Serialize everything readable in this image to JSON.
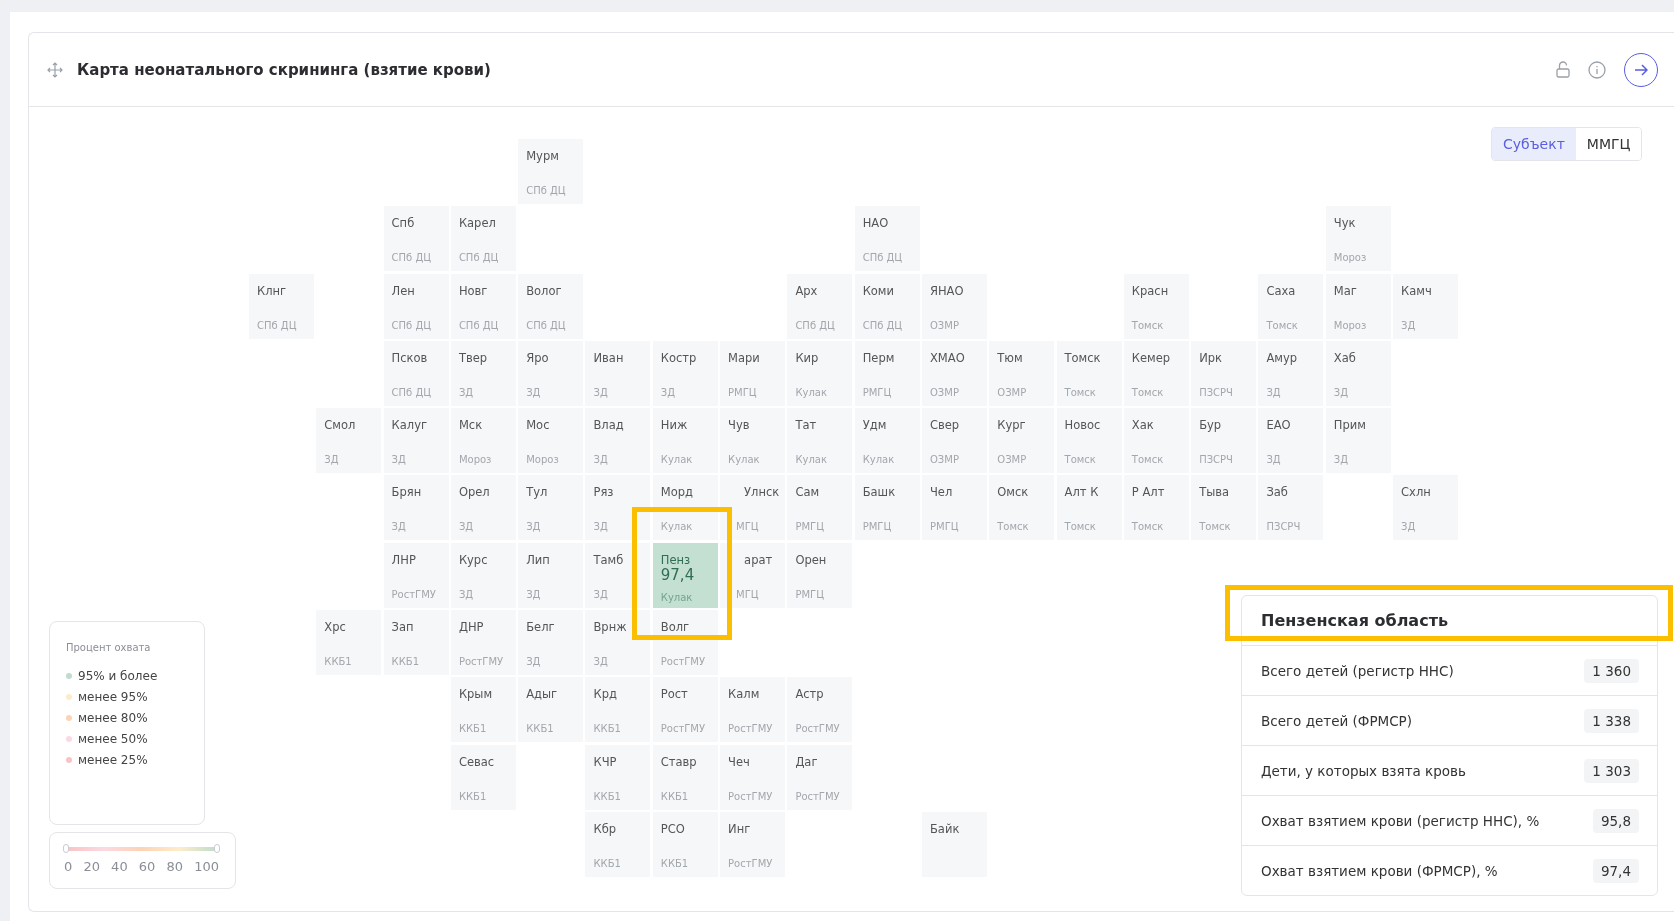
{
  "widget": {
    "title": "Карта неонатального скрининга (взятие крови)"
  },
  "view_toggle": [
    {
      "label": "Субъект",
      "selected": true
    },
    {
      "label": "ММГЦ",
      "selected": false
    }
  ],
  "map_rows": [
    [
      null,
      null,
      null,
      null,
      {
        "name": "Мурм",
        "org": "СПб ДЦ",
        "selected": false
      }
    ],
    [
      null,
      null,
      {
        "name": "Спб",
        "org": "СПб ДЦ",
        "selected": false
      },
      {
        "name": "Карел",
        "org": "СПб ДЦ",
        "selected": false
      },
      null,
      null,
      null,
      null,
      null,
      {
        "name": "НАО",
        "org": "СПб ДЦ",
        "selected": false
      },
      null,
      null,
      null,
      null,
      null,
      null,
      {
        "name": "Чук",
        "org": "Мороз",
        "selected": false
      }
    ],
    [
      {
        "name": "Клнг",
        "org": "СПб ДЦ",
        "selected": false
      },
      null,
      {
        "name": "Лен",
        "org": "СПб ДЦ",
        "selected": false
      },
      {
        "name": "Новг",
        "org": "СПб ДЦ",
        "selected": false
      },
      {
        "name": "Волог",
        "org": "СПб ДЦ",
        "selected": false
      },
      null,
      null,
      null,
      {
        "name": "Арх",
        "org": "СПб ДЦ",
        "selected": false
      },
      {
        "name": "Коми",
        "org": "СПб ДЦ",
        "selected": false
      },
      {
        "name": "ЯНАО",
        "org": "ОЗМР",
        "selected": false
      },
      null,
      null,
      {
        "name": "Красн",
        "org": "Томск",
        "selected": false
      },
      null,
      {
        "name": "Саха",
        "org": "Томск",
        "selected": false
      },
      {
        "name": "Маг",
        "org": "Мороз",
        "selected": false
      },
      {
        "name": "Камч",
        "org": "ЗД",
        "selected": false
      }
    ],
    [
      null,
      null,
      {
        "name": "Псков",
        "org": "СПб ДЦ",
        "selected": false
      },
      {
        "name": "Твер",
        "org": "ЗД",
        "selected": false
      },
      {
        "name": "Яро",
        "org": "ЗД",
        "selected": false
      },
      {
        "name": "Иван",
        "org": "ЗД",
        "selected": false
      },
      {
        "name": "Костр",
        "org": "ЗД",
        "selected": false
      },
      {
        "name": "Мари",
        "org": "РМГЦ",
        "selected": false
      },
      {
        "name": "Кир",
        "org": "Кулак",
        "selected": false
      },
      {
        "name": "Перм",
        "org": "РМГЦ",
        "selected": false
      },
      {
        "name": "ХМАО",
        "org": "ОЗМР",
        "selected": false
      },
      {
        "name": "Тюм",
        "org": "ОЗМР",
        "selected": false
      },
      {
        "name": "Томск",
        "org": "Томск",
        "selected": false
      },
      {
        "name": "Кемер",
        "org": "Томск",
        "selected": false
      },
      {
        "name": "Ирк",
        "org": "ПЗСРЧ",
        "selected": false
      },
      {
        "name": "Амур",
        "org": "ЗД",
        "selected": false
      },
      {
        "name": "Хаб",
        "org": "ЗД",
        "selected": false
      }
    ],
    [
      null,
      {
        "name": "Смол",
        "org": "ЗД",
        "selected": false
      },
      {
        "name": "Калуг",
        "org": "ЗД",
        "selected": false
      },
      {
        "name": "Мск",
        "org": "Мороз",
        "selected": false
      },
      {
        "name": "Мос",
        "org": "Мороз",
        "selected": false
      },
      {
        "name": "Влад",
        "org": "ЗД",
        "selected": false
      },
      {
        "name": "Ниж",
        "org": "Кулак",
        "selected": false
      },
      {
        "name": "Чув",
        "org": "Кулак",
        "selected": false
      },
      {
        "name": "Тат",
        "org": "Кулак",
        "selected": false
      },
      {
        "name": "Удм",
        "org": "Кулак",
        "selected": false
      },
      {
        "name": "Свер",
        "org": "ОЗМР",
        "selected": false
      },
      {
        "name": "Кург",
        "org": "ОЗМР",
        "selected": false
      },
      {
        "name": "Новос",
        "org": "Томск",
        "selected": false
      },
      {
        "name": "Хак",
        "org": "Томск",
        "selected": false
      },
      {
        "name": "Бур",
        "org": "ПЗСРЧ",
        "selected": false
      },
      {
        "name": "ЕАО",
        "org": "ЗД",
        "selected": false
      },
      {
        "name": "Прим",
        "org": "ЗД",
        "selected": false
      }
    ],
    [
      null,
      null,
      {
        "name": "Брян",
        "org": "ЗД",
        "selected": false
      },
      {
        "name": "Орел",
        "org": "ЗД",
        "selected": false
      },
      {
        "name": "Тул",
        "org": "ЗД",
        "selected": false
      },
      {
        "name": "Ряз",
        "org": "ЗД",
        "selected": false
      },
      {
        "name": "Морд",
        "org": "Кулак",
        "selected": false
      },
      {
        "name": "Улнск",
        "org": "МГЦ",
        "selected": false,
        "kind": "covered"
      },
      {
        "name": "Сам",
        "org": "РМГЦ",
        "selected": false
      },
      {
        "name": "Башк",
        "org": "РМГЦ",
        "selected": false
      },
      {
        "name": "Чел",
        "org": "РМГЦ",
        "selected": false
      },
      {
        "name": "Омск",
        "org": "Томск",
        "selected": false
      },
      {
        "name": "Алт К",
        "org": "Томск",
        "selected": false
      },
      {
        "name": "Р Алт",
        "org": "Томск",
        "selected": false
      },
      {
        "name": "Тыва",
        "org": "Томск",
        "selected": false
      },
      {
        "name": "Заб",
        "org": "ПЗСРЧ",
        "selected": false
      },
      null,
      {
        "name": "Схлн",
        "org": "ЗД",
        "selected": false
      }
    ],
    [
      null,
      null,
      {
        "name": "ЛНР",
        "org": "РостГМУ",
        "selected": false
      },
      {
        "name": "Курс",
        "org": "ЗД",
        "selected": false
      },
      {
        "name": "Лип",
        "org": "ЗД",
        "selected": false
      },
      {
        "name": "Тамб",
        "org": "ЗД",
        "selected": false
      },
      {
        "name": "Пенз",
        "value": "97,4",
        "org": "Кулак",
        "selected": true
      },
      {
        "name": "арат",
        "org": "МГЦ",
        "selected": false,
        "kind": "covered"
      },
      {
        "name": "Орен",
        "org": "РМГЦ",
        "selected": false
      }
    ],
    [
      null,
      {
        "name": "Хрс",
        "org": "ККБ1",
        "selected": false
      },
      {
        "name": "Зап",
        "org": "ККБ1",
        "selected": false
      },
      {
        "name": "ДНР",
        "org": "РостГМУ",
        "selected": false
      },
      {
        "name": "Белг",
        "org": "ЗД",
        "selected": false
      },
      {
        "name": "Врнж",
        "org": "ЗД",
        "selected": false
      },
      {
        "name": "Волг",
        "org": "РостГМУ",
        "selected": false
      }
    ],
    [
      null,
      null,
      null,
      {
        "name": "Крым",
        "org": "ККБ1",
        "selected": false
      },
      {
        "name": "Адыг",
        "org": "ККБ1",
        "selected": false
      },
      {
        "name": "Крд",
        "org": "ККБ1",
        "selected": false
      },
      {
        "name": "Рост",
        "org": "РостГМУ",
        "selected": false
      },
      {
        "name": "Калм",
        "org": "РостГМУ",
        "selected": false
      },
      {
        "name": "Астр",
        "org": "РостГМУ",
        "selected": false
      }
    ],
    [
      null,
      null,
      null,
      {
        "name": "Севас",
        "org": "ККБ1",
        "selected": false
      },
      null,
      {
        "name": "КЧР",
        "org": "ККБ1",
        "selected": false
      },
      {
        "name": "Ставр",
        "org": "ККБ1",
        "selected": false
      },
      {
        "name": "Чеч",
        "org": "РостГМУ",
        "selected": false
      },
      {
        "name": "Даг",
        "org": "РостГМУ",
        "selected": false
      }
    ],
    [
      null,
      null,
      null,
      null,
      null,
      {
        "name": "Кбр",
        "org": "ККБ1",
        "selected": false
      },
      {
        "name": "РСО",
        "org": "ККБ1",
        "selected": false
      },
      {
        "name": "Инг",
        "org": "РостГМУ",
        "selected": false
      },
      null,
      null,
      {
        "name": "Байк",
        "selected": false
      }
    ]
  ],
  "legend": {
    "title": "Процент охвата",
    "items": [
      {
        "label": "95% и более",
        "color": "#bfdccc"
      },
      {
        "label": "менее 95%",
        "color": "#fdeccb"
      },
      {
        "label": "менее 80%",
        "color": "#fdd3b5"
      },
      {
        "label": "менее 50%",
        "color": "#fbd9e2"
      },
      {
        "label": "менее 25%",
        "color": "#f9c3c3"
      }
    ]
  },
  "range": {
    "handles": [
      {
        "level": 0
      },
      {
        "level": 1
      }
    ],
    "ticks": [
      "0",
      "20",
      "40",
      "60",
      "80",
      "100"
    ]
  },
  "details": {
    "title": "Пензенская область",
    "rows": [
      {
        "label": "Всего детей (регистр ННС)",
        "value": "1 360"
      },
      {
        "label": "Всего детей (ФРМСР)",
        "value": "1 338"
      },
      {
        "label": "Дети, у которых взята кровь",
        "value": "1 303"
      },
      {
        "label": "Охват взятием крови (регистр ННС), %",
        "value": "95,8"
      },
      {
        "label": "Охват взятием крови (ФРМСР), %",
        "value": "97,4"
      }
    ]
  }
}
